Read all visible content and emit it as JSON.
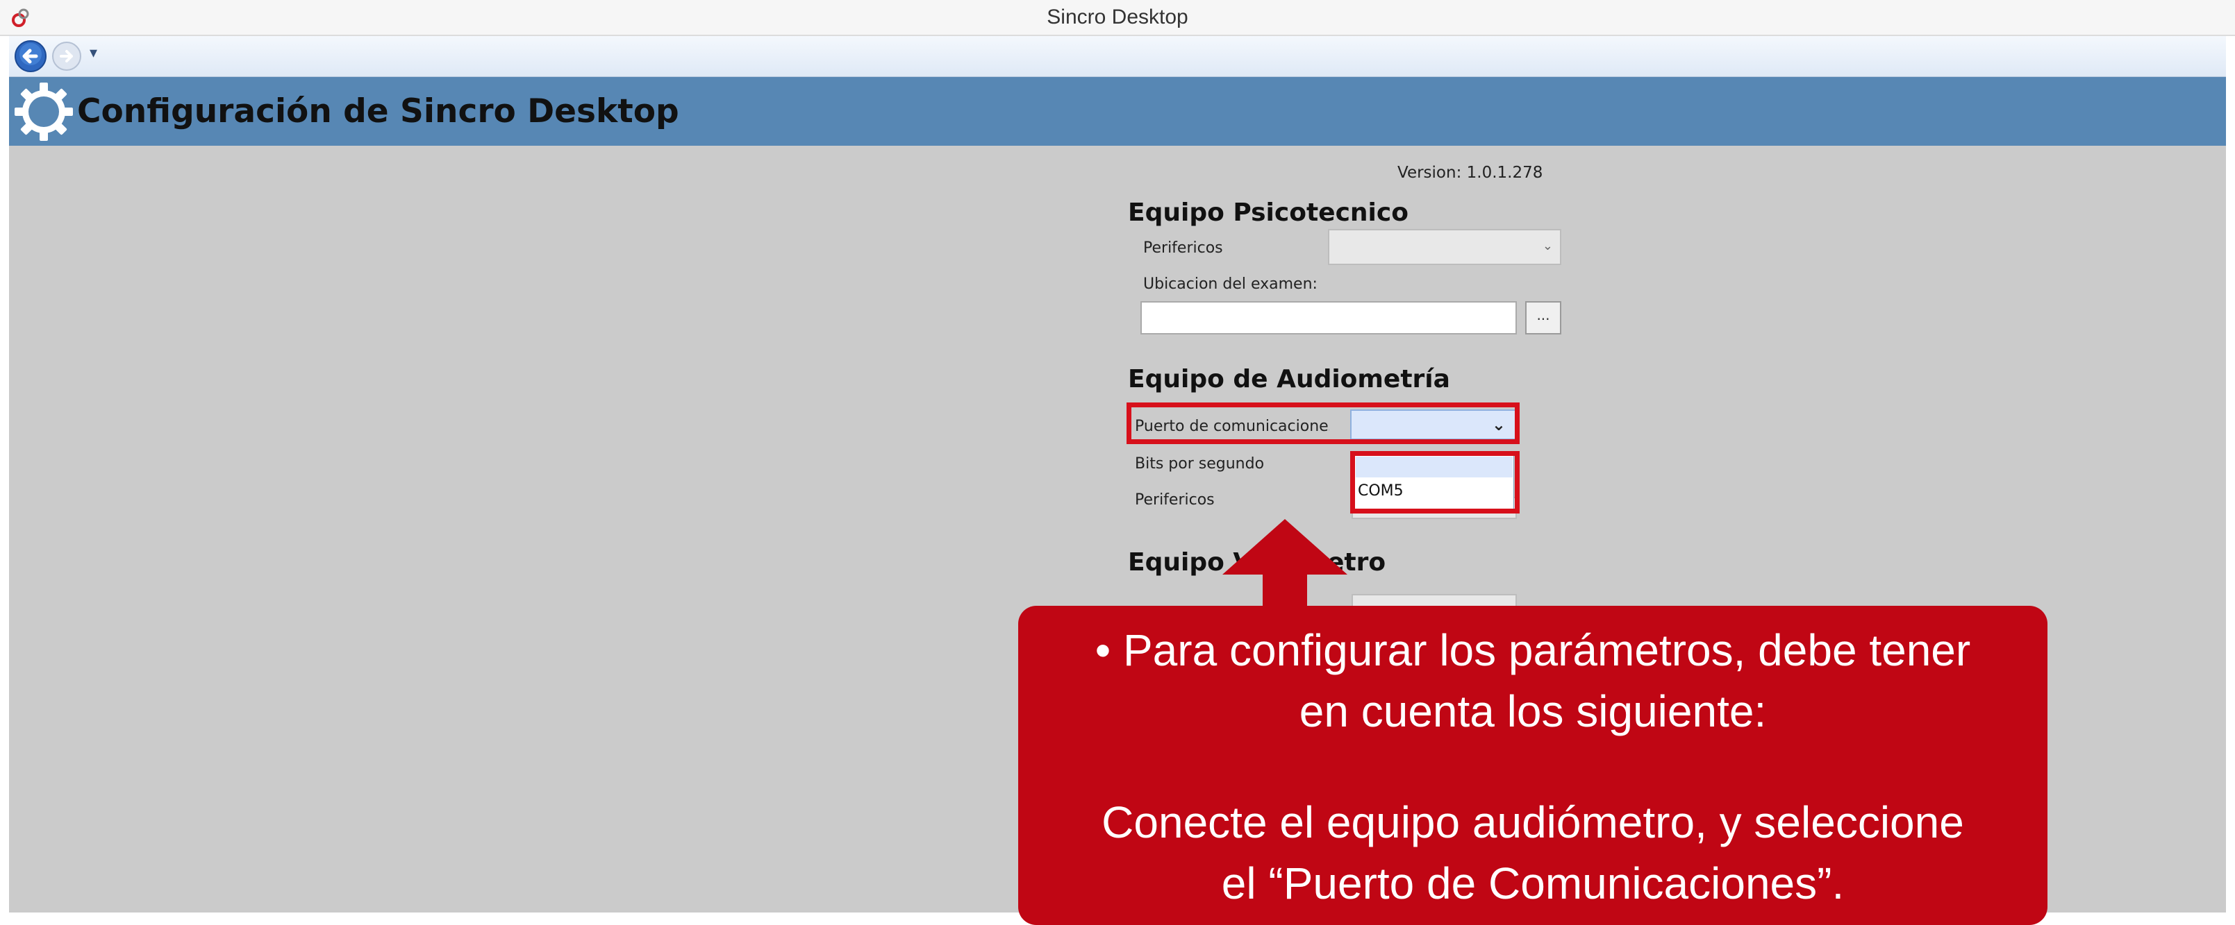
{
  "window": {
    "title": "Sincro Desktop"
  },
  "header": {
    "title": "Configuración de Sincro Desktop"
  },
  "version_label": "Version: 1.0.1.278",
  "sections": {
    "psicotecnico": {
      "title": "Equipo Psicotecnico",
      "perifericos_label": "Perifericos",
      "ubicacion_label": "Ubicacion del examen:",
      "browse_label": "..."
    },
    "audiometria": {
      "title": "Equipo de Audiometría",
      "puerto_label": "Puerto de comunicaciones",
      "bits_label": "Bits por segundo",
      "perifericos_label": "Perifericos",
      "dropdown_options": [
        "COM5"
      ]
    },
    "visiometro": {
      "title": "Equipo Visiometro"
    }
  },
  "callout": {
    "line1": "• Para configurar los parámetros, debe tener",
    "line2": "en cuenta los siguiente:",
    "line3": "Conecte el equipo audiómetro, y seleccione",
    "line4": "el “Puerto de Comunicaciones”."
  },
  "colors": {
    "header_band": "#5787b4",
    "content_bg": "#cbcbcb",
    "callout_bg": "#c00614",
    "highlight": "#d7101b"
  }
}
